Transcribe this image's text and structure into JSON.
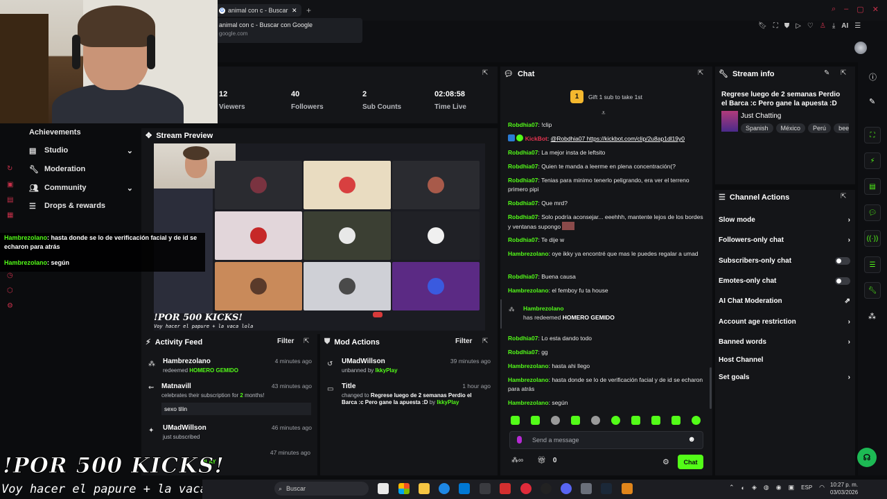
{
  "browser": {
    "tab_title": "animal con c - Buscar con Google",
    "tab_close": "✕",
    "tab_new": "+",
    "suggest_title": "animal con c - Buscar con Google",
    "suggest_url": "google.com",
    "ai_label": "AI"
  },
  "stats": [
    {
      "value": "12",
      "label": "Viewers"
    },
    {
      "value": "40",
      "label": "Followers"
    },
    {
      "value": "2",
      "label": "Sub Counts"
    },
    {
      "value": "02:08:58",
      "label": "Time Live"
    }
  ],
  "nav": {
    "items": [
      {
        "label": "Achievements"
      },
      {
        "label": "Studio"
      },
      {
        "label": "Moderation"
      },
      {
        "label": "Community"
      },
      {
        "label": "Drops & rewards"
      }
    ]
  },
  "preview": {
    "title": "Stream Preview",
    "overlay_kicks": "!POR 500 KICKS!",
    "overlay_line": "Voy hacer el papure + la vaca lola"
  },
  "activity": {
    "title": "Activity Feed",
    "filter": "Filter",
    "rows": [
      {
        "name": "Hambrezolano",
        "pre": "redeemed ",
        "hl": "HOMERO GEMIDO",
        "post": "",
        "time": "4 minutes ago"
      },
      {
        "name": "Matnavill",
        "pre": "celebrates their subscription for ",
        "hl": "2",
        "post": " months!",
        "time": "43 minutes ago",
        "quote": "sexo tilin"
      },
      {
        "name": "UMadWillson",
        "pre": "just subscribed",
        "hl": "",
        "post": "",
        "time": "46 minutes ago"
      },
      {
        "name": "",
        "pre": "",
        "hl": "",
        "post": "",
        "time": "47 minutes ago"
      }
    ]
  },
  "mod": {
    "title": "Mod Actions",
    "filter": "Filter",
    "rows": [
      {
        "name": "UMadWillson",
        "pre": "unbanned by ",
        "hl": "IkkyPlay",
        "time": "39 minutes ago"
      },
      {
        "name": "Title",
        "pre": "changed to ",
        "bold": "Regrese luego de 2 semanas Perdio el Barca :c Pero gane la apuesta :D",
        "by": " by ",
        "hl": "IkkyPlay",
        "time": "1 hour ago"
      }
    ]
  },
  "chat": {
    "title": "Chat",
    "gift": "Gift 1 sub to take 1st",
    "messages": [
      {
        "user": "Robdhia07",
        "text": "!clip"
      },
      {
        "user": "KickBot",
        "text": "@Robdhia07 https://kickbot.com/clip/2u8ap1dl19y0"
      },
      {
        "user": "Robdhia07",
        "text": "La mejor insta de leftsito"
      },
      {
        "user": "Robdhia07",
        "text": "Quien te manda a leerme en plena concentración(?"
      },
      {
        "user": "Robdhia07",
        "text": "Tenias para minimo tenerlo peligrando, era ver el terreno primero pipi"
      },
      {
        "user": "Robdhia07",
        "text": "Que mrd?"
      },
      {
        "user": "Robdhia07",
        "text": "Solo podría aconsejar... eeehhh, mantente lejos de los bordes y ventanas supongo"
      },
      {
        "user": "Robdhia07",
        "text": "Te dije w"
      },
      {
        "user": "Hambrezolano",
        "text": "oye ikky ya encontré que mas le puedes regalar a umad"
      },
      {
        "user": "Robdhia07",
        "text": "Buena causa"
      },
      {
        "user": "Hambrezolano",
        "text": "el femboy fu ta house"
      },
      {
        "user": "Robdhia07",
        "text": "Lo esta dando todo"
      },
      {
        "user": "Robdhia07",
        "text": "gg"
      },
      {
        "user": "Hambrezolano",
        "text": "hasta ahi llego"
      },
      {
        "user": "Hambrezolano",
        "text": "hasta donde se lo de verificación facial y de id se echaron para atrás"
      },
      {
        "user": "Hambrezolano",
        "text": "según"
      }
    ],
    "redeem_user": "Hambrezolano",
    "redeem_pre": "has redeemed",
    "redeem_item": "HOMERO GEMIDO",
    "placeholder": "Send a message",
    "count": "0",
    "send": "Chat"
  },
  "info": {
    "title": "Stream info",
    "stream_title": "Regrese luego de 2 semanas Perdio el Barca :c Pero gane la apuesta :D",
    "category": "Just Chatting",
    "tags": [
      "Spanish",
      "México",
      "Perú",
      "bee"
    ]
  },
  "actions": {
    "title": "Channel Actions",
    "items": [
      {
        "label": "Slow mode",
        "ctl": "chevron"
      },
      {
        "label": "Followers-only chat",
        "ctl": "chevron"
      },
      {
        "label": "Subscribers-only chat",
        "ctl": "toggle"
      },
      {
        "label": "Emotes-only chat",
        "ctl": "toggle"
      },
      {
        "label": "AI Chat Moderation",
        "ctl": "external"
      },
      {
        "label": "Account age restriction",
        "ctl": "chevron"
      },
      {
        "label": "Banned words",
        "ctl": "chevron"
      },
      {
        "label": "Host Channel",
        "ctl": "none"
      },
      {
        "label": "Set goals",
        "ctl": "chevron"
      }
    ]
  },
  "overlay_chat": [
    {
      "user": "Hambrezolano",
      "text": "hasta donde se lo de verificación facial y de id se echaron para atrás"
    },
    {
      "user": "Hambrezolano",
      "text": "según"
    }
  ],
  "overlay_play": "PLAY",
  "taskbar": {
    "search": "Buscar",
    "lang": "ESP",
    "time": "10:27 p. m.",
    "date": "03/03/2026"
  },
  "colors": {
    "accent": "#53fc18",
    "bg": "#0b0c0e",
    "panel": "#141518"
  }
}
